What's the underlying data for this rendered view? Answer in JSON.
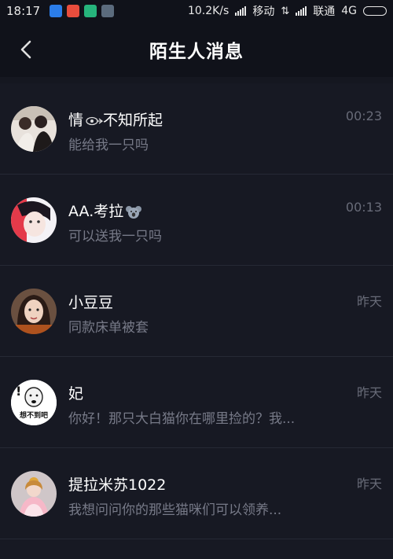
{
  "status_bar": {
    "time": "18:17",
    "network_speed": "10.2K/s",
    "carrier1": "移动",
    "carrier2": "联通",
    "network_type": "4G",
    "app_icons": [
      "notification-icon",
      "mail-icon",
      "app-icon",
      "app-icon"
    ]
  },
  "header": {
    "title": "陌生人消息"
  },
  "conversations": [
    {
      "name": "情",
      "name_suffix": "不知所起",
      "name_emoji": "eye-pointing-emoji",
      "message": "能给我一只吗",
      "time": "00:23"
    },
    {
      "name": "AA.考拉",
      "name_suffix": "",
      "name_emoji": "koala-emoji",
      "message": "可以送我一只吗",
      "time": "00:13"
    },
    {
      "name": "小豆豆",
      "name_suffix": "",
      "name_emoji": "",
      "message": "同款床单被套",
      "time": "昨天"
    },
    {
      "name": "妃",
      "name_suffix": "",
      "name_emoji": "",
      "message": "你好！那只大白猫你在哪里捡的？我...",
      "time": "昨天",
      "avatar_text": "想不到吧"
    },
    {
      "name": "提拉米苏1022",
      "name_suffix": "",
      "name_emoji": "",
      "message": " 我想问问你的那些猫咪们可以领养...",
      "time": "昨天"
    }
  ]
}
